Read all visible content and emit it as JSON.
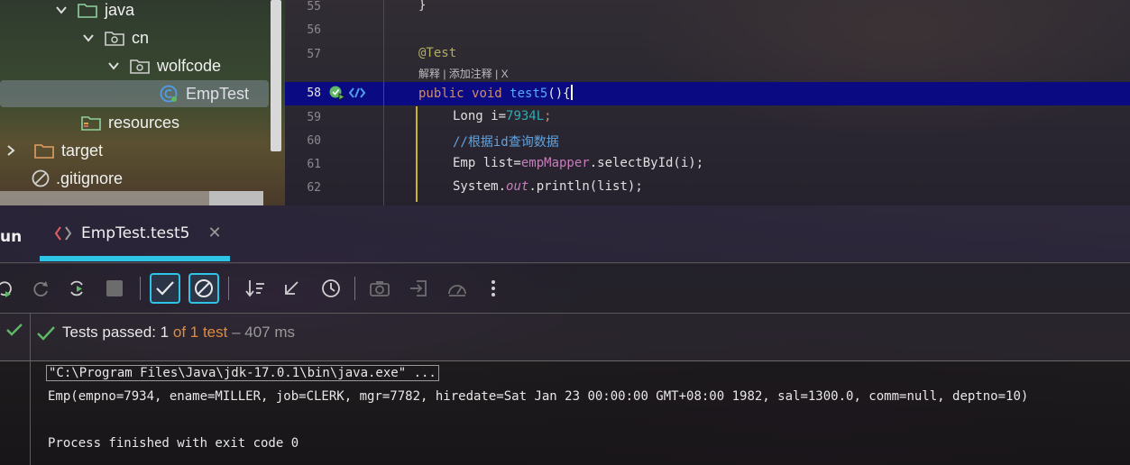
{
  "project_tree": {
    "items": [
      {
        "label": "java",
        "icon": "source-folder-icon",
        "expanded": true
      },
      {
        "label": "cn",
        "icon": "package-icon",
        "expanded": true
      },
      {
        "label": "wolfcode",
        "icon": "package-icon",
        "expanded": true
      },
      {
        "label": "EmpTest",
        "icon": "test-class-icon",
        "selected": true
      },
      {
        "label": "resources",
        "icon": "resources-folder-icon"
      },
      {
        "label": "target",
        "icon": "folder-icon",
        "expanded": false
      },
      {
        "label": ".gitignore",
        "icon": "ignore-file-icon"
      }
    ]
  },
  "editor": {
    "line_numbers": [
      "55",
      "56",
      "57",
      "58",
      "59",
      "60",
      "61",
      "62"
    ],
    "hint_text": "解释 | 添加注释 | X",
    "code": {
      "l55": "}",
      "l57_annotation": "@Test",
      "l58_public": "public",
      "l58_void": "void",
      "l58_name": "test5",
      "l58_rest": "(){",
      "l59_type": "Long i=",
      "l59_num": "7934L",
      "l59_end": ";",
      "l60_comment": "//根据id查询数据",
      "l61_start": "Emp list=",
      "l61_field": "empMapper",
      "l61_end": ".selectById(i);",
      "l62_start": "System.",
      "l62_out": "out",
      "l62_end": ".println(list);"
    }
  },
  "run_panel": {
    "title": "un",
    "tab_label": "EmpTest.test5",
    "status": {
      "passed_prefix": "Tests passed: ",
      "passed_count": "1",
      "of_text": "of 1 test",
      "duration": "– 407 ms"
    },
    "console": {
      "cmd": "\"C:\\Program Files\\Java\\jdk-17.0.1\\bin\\java.exe\" ...",
      "output": "Emp(empno=7934, ename=MILLER, job=CLERK, mgr=7782, hiredate=Sat Jan 23 00:00:00 GMT+08:00 1982, sal=1300.0, comm=null, deptno=10)",
      "exit": "Process finished with exit code 0"
    }
  },
  "colors": {
    "accent": "#2ec4e6",
    "pass_green": "#5fb865",
    "highlight_line": "#0a0a82",
    "of_text_orange": "#e08a3c"
  }
}
